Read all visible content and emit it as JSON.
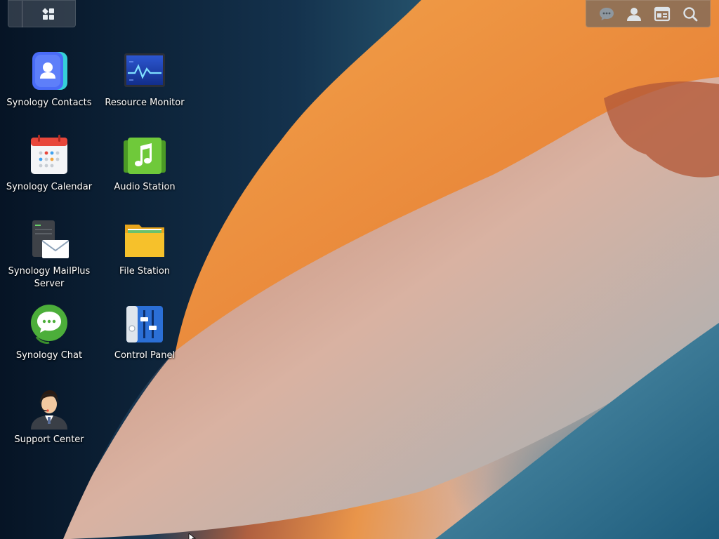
{
  "topbar": {
    "left": {
      "icons": [
        "main-menu-icon"
      ]
    },
    "right": {
      "icons": [
        "chat-icon",
        "user-icon",
        "widgets-icon",
        "search-icon"
      ]
    }
  },
  "desktop": {
    "shortcuts": [
      {
        "label": "Synology Contacts",
        "icon": "contacts-icon"
      },
      {
        "label": "Resource Monitor",
        "icon": "resource-monitor-icon"
      },
      {
        "label": "Synology Calendar",
        "icon": "calendar-icon"
      },
      {
        "label": "Audio Station",
        "icon": "music-note-icon"
      },
      {
        "label": "Synology MailPlus Server",
        "icon": "mail-server-icon"
      },
      {
        "label": "File Station",
        "icon": "folder-icon"
      },
      {
        "label": "Synology Chat",
        "icon": "chat-bubble-icon"
      },
      {
        "label": "Control Panel",
        "icon": "control-panel-icon"
      },
      {
        "label": "Support Center",
        "icon": "support-agent-icon"
      }
    ]
  },
  "colors": {
    "accent": "#4a6cf7",
    "audio_green": "#5db82e",
    "chat_green": "#4cae3a",
    "folder_yellow": "#f6c12b",
    "control_blue": "#2b6fd6"
  }
}
